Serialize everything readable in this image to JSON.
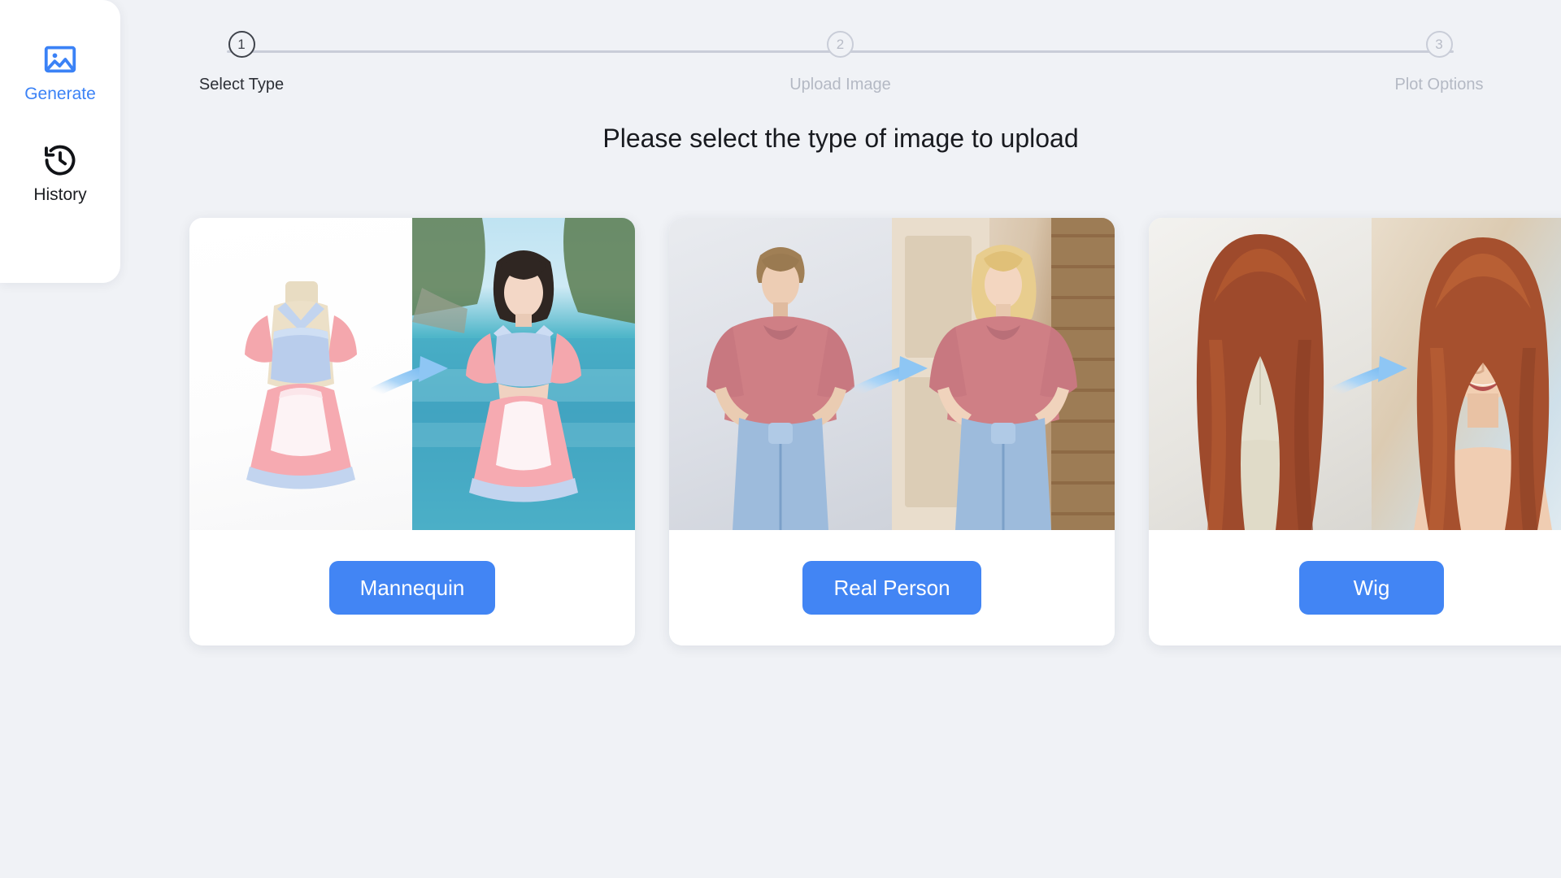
{
  "app": {
    "background_color": "#f0f2f6",
    "accent_color": "#4285f4"
  },
  "sidebar": {
    "items": [
      {
        "id": "generate",
        "label": "Generate",
        "icon": "image-icon",
        "active": true
      },
      {
        "id": "history",
        "label": "History",
        "icon": "clock-rewind-icon",
        "active": false
      }
    ]
  },
  "stepper": {
    "current_step": 1,
    "steps": [
      {
        "number": "1",
        "label": "Select Type",
        "state": "active"
      },
      {
        "number": "2",
        "label": "Upload Image",
        "state": "pending"
      },
      {
        "number": "3",
        "label": "Plot Options",
        "state": "pending"
      }
    ]
  },
  "main": {
    "heading": "Please select the type of image to upload",
    "cards": [
      {
        "id": "mannequin",
        "button_label": "Mannequin",
        "before_alt": "Maid outfit on a headless mannequin, white studio background",
        "after_alt": "Woman wearing the maid outfit at a tropical beach cove",
        "arrow_icon": "curved-arrow-right-icon"
      },
      {
        "id": "real-person",
        "button_label": "Real Person",
        "before_alt": "Model in pink oversized t-shirt and jeans on gray studio backdrop",
        "after_alt": "Blonde model in the same outfit standing in a doorway",
        "arrow_icon": "curved-arrow-right-icon"
      },
      {
        "id": "wig",
        "button_label": "Wig",
        "before_alt": "Auburn wig on a faceless mannequin head",
        "after_alt": "Smiling woman wearing the auburn hair",
        "arrow_icon": "curved-arrow-right-icon"
      }
    ]
  }
}
